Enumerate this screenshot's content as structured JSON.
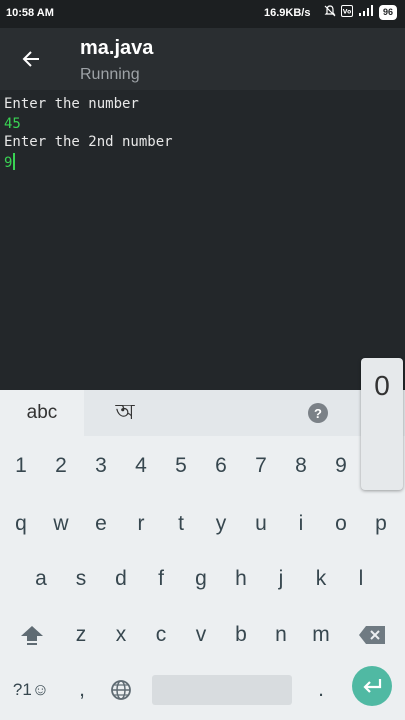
{
  "status_bar": {
    "time": "10:58 AM",
    "network_speed": "16.9KB/s",
    "network_type": "4G",
    "volte": "VoLTE",
    "battery": "96"
  },
  "app_bar": {
    "title": "ma.java",
    "subtitle": "Running",
    "back_icon": "arrow-left-icon"
  },
  "terminal": {
    "lines": [
      {
        "text": "Enter the number",
        "kind": "output"
      },
      {
        "text": "45",
        "kind": "input"
      },
      {
        "text": "Enter the 2nd number",
        "kind": "output"
      },
      {
        "text": "9",
        "kind": "input"
      }
    ],
    "output_color": "#e8e8e8",
    "input_color": "#39d353"
  },
  "keyboard": {
    "suggestions": {
      "abc": "abc",
      "bengali": "অ",
      "help": "?"
    },
    "popup_key": "0",
    "number_row": [
      "1",
      "2",
      "3",
      "4",
      "5",
      "6",
      "7",
      "8",
      "9"
    ],
    "row1": [
      "q",
      "w",
      "e",
      "r",
      "t",
      "y",
      "u",
      "i",
      "o",
      "p"
    ],
    "row2": [
      "a",
      "s",
      "d",
      "f",
      "g",
      "h",
      "j",
      "k",
      "l"
    ],
    "row3": [
      "z",
      "x",
      "c",
      "v",
      "b",
      "n",
      "m"
    ],
    "bottom": {
      "symbols": "?1☺",
      "comma": ",",
      "period": "."
    },
    "accent_color": "#50b9a3"
  }
}
